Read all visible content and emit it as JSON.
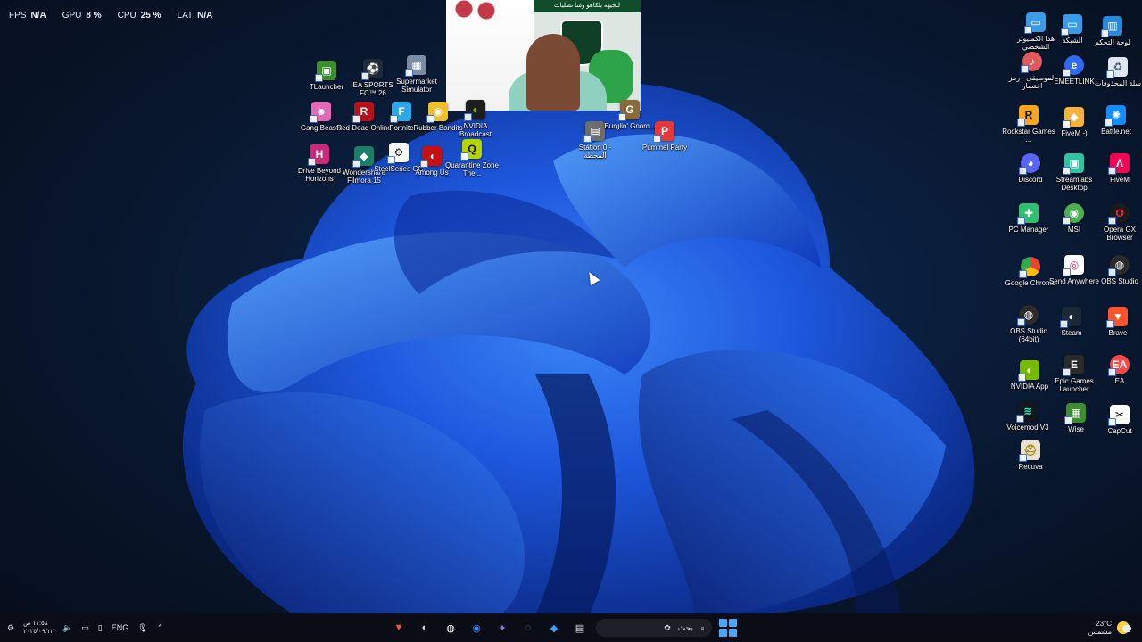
{
  "overlay": {
    "items": [
      {
        "key": "FPS",
        "value": "N/A"
      },
      {
        "key": "GPU",
        "value": "8 %"
      },
      {
        "key": "CPU",
        "value": "25 %"
      },
      {
        "key": "LAT",
        "value": "N/A"
      }
    ]
  },
  "webcam": {
    "banner": "للجيهة بلكاهو ومنا تصليات"
  },
  "icons": {
    "tlauncher": "TLauncher",
    "ea_fc": "EA SPORTS FC™ 26",
    "supermarket": "Supermarket Simulator",
    "gang_beasts": "Gang Beasts",
    "red_dead": "Red Dead Online",
    "fortnite": "Fortnite",
    "rubber_bandits": "Rubber Bandits",
    "nvidia_broadcast": "NVIDIA Broadcast",
    "drive_beyond": "Drive Beyond Horizons",
    "filmora": "Wondershare Filmora 15",
    "steelseries": "SteelSeries GG",
    "among_us": "Among Us",
    "quarantine": "Quarantine Zone The...",
    "station0": "Station 0 - المحطة",
    "burglin": "Burglin' Gnom...",
    "pummel": "Pummel Party",
    "this_pc": "هذا الكمبيوتر الشخصي",
    "network": "الشبكة",
    "control_panel": "لوحة التحكم",
    "music": "الموسيقى - رمز اختصار",
    "emeetlink": "EMEETLINK",
    "recycle": "سلة المحذوفات",
    "rockstar": "Rockstar Games ...",
    "fivem_dash": "FiveM -)",
    "battlenet": "Battle.net",
    "discord": "Discord",
    "streamlabs": "Streamlabs Desktop",
    "fivem": "FiveM",
    "pc_manager": "PC Manager",
    "msi": "MSI",
    "opera": "Opera GX Browser",
    "chrome": "Google Chrome",
    "send_anywhere": "Send Anywhere",
    "obs": "OBS Studio",
    "obs64": "OBS Studio (64bit)",
    "steam": "Steam",
    "brave": "Brave",
    "nvidia_app": "NVIDIA App",
    "epic": "Epic Games Launcher",
    "ea": "EA",
    "voicemod": "Voicemod V3",
    "wise": "Wise",
    "capcut": "CapCut",
    "recuva": "Recuva"
  },
  "taskbar": {
    "time": "١١:٥٨ ص",
    "date": "٢٠٢٥/٠٩/١٢",
    "language": "ENG",
    "search_placeholder": "بحث",
    "temperature": "23°C",
    "weather": "مشمس"
  },
  "colors": {
    "accent": "#2a6cff",
    "taskbar": "#0a0e16"
  }
}
